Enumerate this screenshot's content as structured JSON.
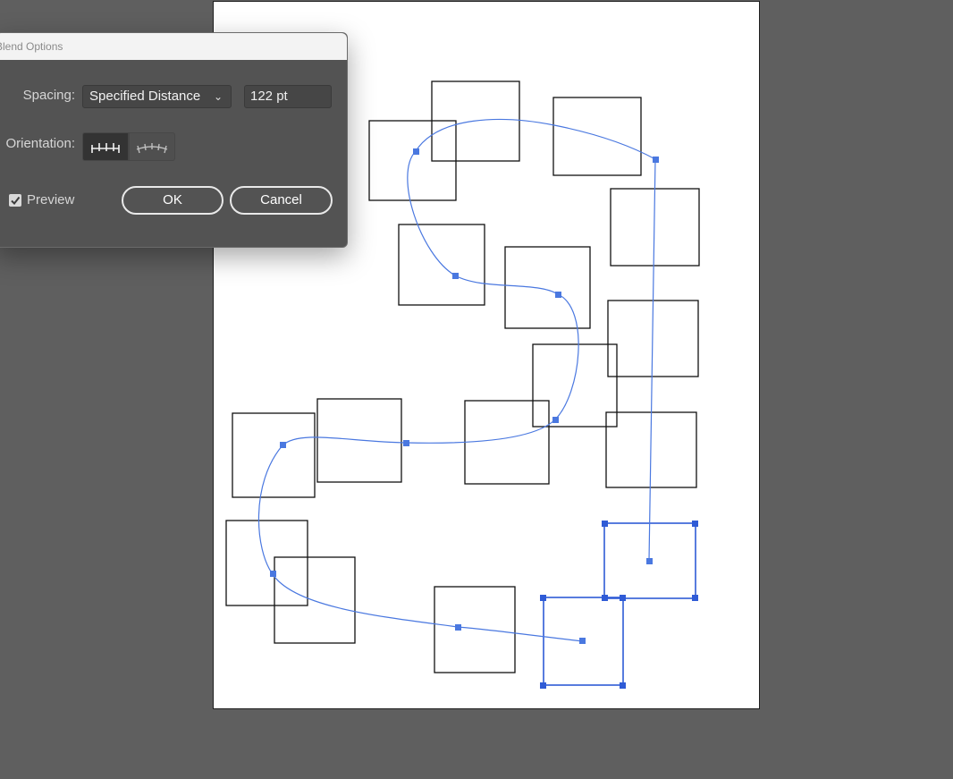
{
  "dialog": {
    "title": "Blend Options",
    "spacing_label": "Spacing:",
    "spacing_value": "Specified Distance",
    "distance_value": "122 pt",
    "orientation_label": "Orientation:",
    "orientation_options": [
      "align-to-page-icon",
      "align-to-path-icon"
    ],
    "orientation_selected": "align-to-page-icon",
    "preview_label": "Preview",
    "preview_checked": true,
    "ok_label": "OK",
    "cancel_label": "Cancel"
  },
  "colors": {
    "canvas": "#5f5f5f",
    "artboard": "#ffffff",
    "dialog_bg": "#535353",
    "path": "#4a78e0",
    "selection": "#2f5bd6"
  }
}
